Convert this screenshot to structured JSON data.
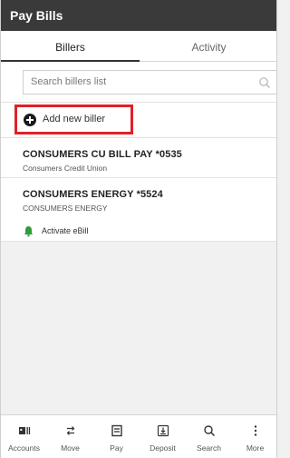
{
  "header": {
    "title": "Pay Bills"
  },
  "tabs": [
    {
      "label": "Billers",
      "active": true
    },
    {
      "label": "Activity",
      "active": false
    }
  ],
  "search": {
    "placeholder": "Search billers list",
    "icon": "search-icon"
  },
  "add_biller": {
    "label": "Add new biller",
    "icon": "plus-circle-icon",
    "highlight_color": "#e0202a"
  },
  "billers": [
    {
      "title": "CONSUMERS CU BILL PAY *0535",
      "subtitle": "Consumers Credit Union"
    },
    {
      "title": "CONSUMERS ENERGY *5524",
      "subtitle": "CONSUMERS ENERGY",
      "action": {
        "label": "Activate eBill",
        "icon": "bell-icon",
        "color": "#2e9d3a"
      }
    }
  ],
  "bottom_nav": [
    {
      "label": "Accounts",
      "icon": "accounts-icon"
    },
    {
      "label": "Move",
      "icon": "transfer-icon"
    },
    {
      "label": "Pay",
      "icon": "receipt-icon"
    },
    {
      "label": "Deposit",
      "icon": "deposit-icon"
    },
    {
      "label": "Search",
      "icon": "search-icon"
    },
    {
      "label": "More",
      "icon": "more-icon"
    }
  ]
}
